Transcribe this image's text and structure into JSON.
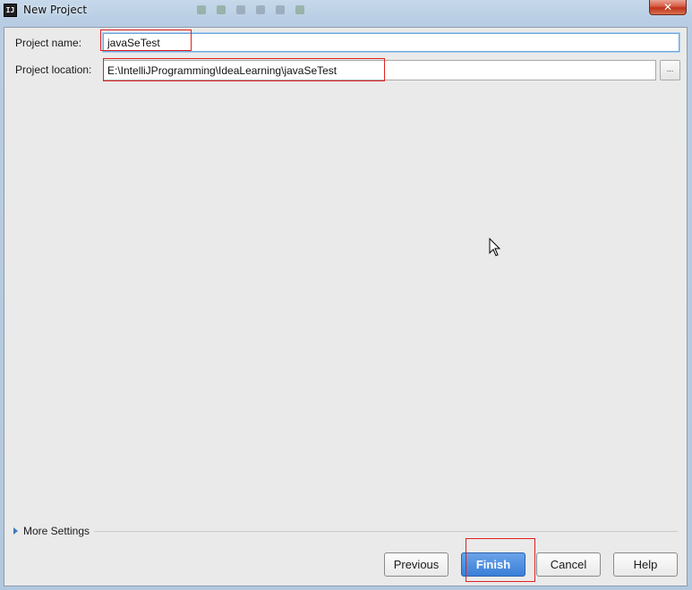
{
  "window": {
    "title": "New Project",
    "app_icon_text": "IJ",
    "close_label": "x"
  },
  "form": {
    "project_name_label": "Project name:",
    "project_name_value": "javaSeTest",
    "project_location_label": "Project location:",
    "project_location_value": "E:\\IntelliJProgramming\\IdeaLearning\\javaSeTest",
    "browse_label": "..."
  },
  "more_settings": {
    "label": "More Settings"
  },
  "buttons": {
    "previous": "Previous",
    "finish": "Finish",
    "cancel": "Cancel",
    "help": "Help"
  },
  "icons": {
    "app": "intellij-app-icon",
    "close": "close-icon",
    "expand": "triangle-right-icon",
    "cursor": "mouse-pointer-icon"
  },
  "colors": {
    "accent": "#3a7fd9",
    "highlight_box": "#e02020",
    "dialog_background": "#eaeaea"
  }
}
